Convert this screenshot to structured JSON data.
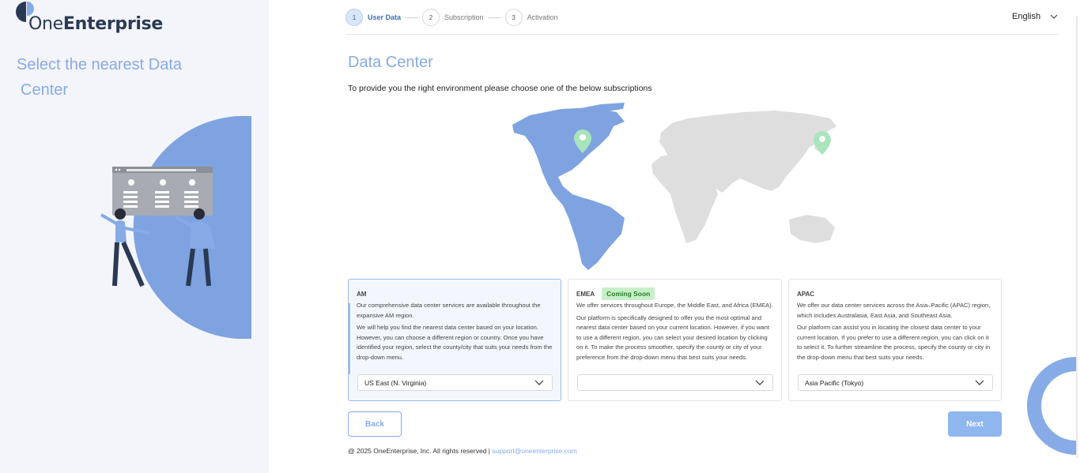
{
  "brand": {
    "name_light": "One",
    "name_bold": "Enterprise"
  },
  "left": {
    "title_line1": "Select the nearest Data",
    "title_line2": "Center"
  },
  "stepper": {
    "steps": [
      {
        "num": "1",
        "label": "User Data"
      },
      {
        "num": "2",
        "label": "Subscription"
      },
      {
        "num": "3",
        "label": "Activation"
      }
    ]
  },
  "language": {
    "selected": "English"
  },
  "main": {
    "title": "Data Center",
    "subtitle": "To provide you the right environment please choose one of the below subscriptions"
  },
  "regions": [
    {
      "title": "AM",
      "badge": "",
      "paragraphs": [
        "Our comprehensive data center services are available throughout the expansive AM region.",
        "We will help you find the nearest data center based on your location. However, you can choose a different region or country. Once you have identified your region, select the county/city that suits your needs from the drop-down menu."
      ],
      "selected": "US East (N. Virginia)"
    },
    {
      "title": "EMEA",
      "badge": "Coming Soon",
      "paragraphs": [
        "We offer services throughout Europe, the Middle East, and Africa (EMEA).",
        "Our platform is specifically designed to offer you the most optimal and nearest data center based on your current location. However, if you want to use a different region, you can select your desired location by clicking on it. To make the process smoother, specify the county or city of your preference from the drop-down menu that best suits your needs."
      ],
      "selected": ""
    },
    {
      "title": "APAC",
      "badge": "",
      "paragraphs": [
        "We offer our data center services across the Asia–Pacific (APAC) region, which includes Australasia, East Asia, and Southeast Asia.",
        "Our platform can assist you in locating the closest data center to your current location. If you prefer to use a different region, you can click on it to select it. To further streamline the process, specify the county or city in the drop-down menu that best suits your needs."
      ],
      "selected": "Asia Pacific (Tokyo)"
    }
  ],
  "buttons": {
    "back": "Back",
    "next": "Next"
  },
  "footer": {
    "copyright": "@ 2025 OneEnterprise, Inc. All rights reserved |",
    "email": "support@oneenterprise.com"
  },
  "colors": {
    "accent": "#86abe6",
    "map_selected": "#7ea3e0",
    "map_other": "#dedede",
    "pin": "#a8e4bc",
    "badge_bg": "#c8f0c8"
  }
}
